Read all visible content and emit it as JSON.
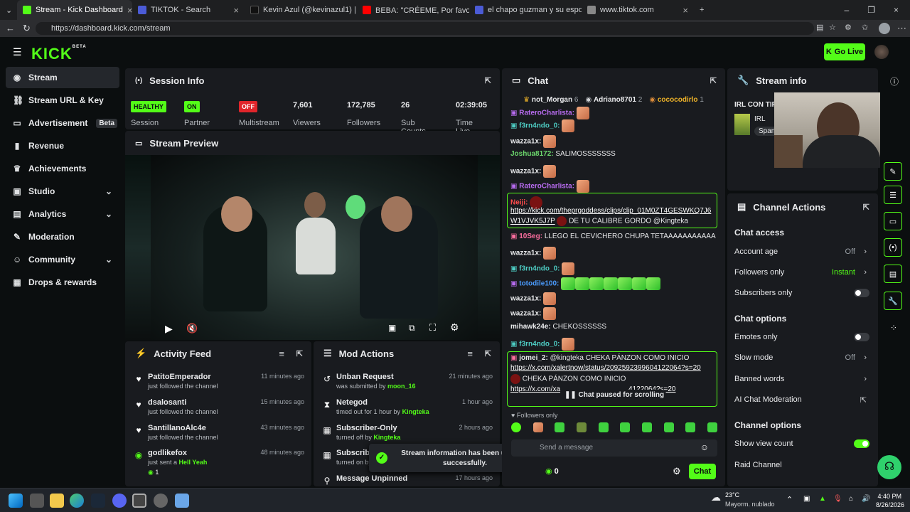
{
  "browser": {
    "tabs": [
      {
        "title": "Stream - Kick Dashboard",
        "fav": "#53fc18"
      },
      {
        "title": "TIKTOK - Search",
        "fav": "#4b5bd6"
      },
      {
        "title": "Kevin Azul (@kevinazul1) | TikTok",
        "fav": "#111111"
      },
      {
        "title": "BEBA: \"CRÉEME, Por favor\" 🙏",
        "fav": "#ff0000"
      },
      {
        "title": "el chapo guzman y su esposa - Se",
        "fav": "#4b5bd6"
      },
      {
        "title": "www.tiktok.com",
        "fav": "#888888"
      }
    ],
    "url": "https://dashboard.kick.com/stream"
  },
  "header": {
    "logo": "KICK",
    "logo_sup": "BETA",
    "go_live": "Go Live"
  },
  "sidebar": {
    "items": [
      {
        "label": "Stream",
        "icon": "signal-icon",
        "glyph": "((•))"
      },
      {
        "label": "Stream URL & Key",
        "icon": "link-icon",
        "glyph": "🔗"
      },
      {
        "label": "Advertisement",
        "icon": "ad-icon",
        "glyph": "▭"
      },
      {
        "label": "Revenue",
        "icon": "chart-icon",
        "glyph": "▮"
      },
      {
        "label": "Achievements",
        "icon": "trophy-icon",
        "glyph": "🏆"
      },
      {
        "label": "Studio",
        "icon": "studio-icon",
        "glyph": "▣"
      },
      {
        "label": "Analytics",
        "icon": "analytics-icon",
        "glyph": "▤"
      },
      {
        "label": "Moderation",
        "icon": "wrench-icon",
        "glyph": "✎"
      },
      {
        "label": "Community",
        "icon": "people-icon",
        "glyph": "☺"
      },
      {
        "label": "Drops & rewards",
        "icon": "gift-icon",
        "glyph": "▦"
      }
    ],
    "beta": "Beta"
  },
  "session": {
    "title": "Session Info",
    "stats": [
      {
        "badge": "HEALTHY",
        "label": "Session",
        "color": "#53fc18"
      },
      {
        "badge": "ON",
        "label": "Partner",
        "color": "#53fc18"
      },
      {
        "badge": "OFF",
        "label": "Multistream",
        "color": "#e0252b"
      },
      {
        "num": "7,601",
        "label": "Viewers"
      },
      {
        "num": "172,785",
        "label": "Followers"
      },
      {
        "num": "26",
        "label": "Sub Counts"
      },
      {
        "num": "02:39:05",
        "label": "Time Live"
      }
    ]
  },
  "preview": {
    "title": "Stream Preview"
  },
  "activity": {
    "title": "Activity Feed",
    "rows": [
      {
        "name": "PatitoEmperador",
        "desc": "just followed the channel",
        "time": "11 minutes ago",
        "icon": "heart-icon"
      },
      {
        "name": "dsalosanti",
        "desc": "just followed the channel",
        "time": "15 minutes ago",
        "icon": "heart-icon"
      },
      {
        "name": "SantillanoAlc4e",
        "desc": "just followed the channel",
        "time": "43 minutes ago",
        "icon": "heart-icon"
      },
      {
        "name": "godlikefox",
        "desc": "just sent a",
        "extra": "Hell Yeah",
        "count": "1",
        "time": "48 minutes ago",
        "icon": "kick-coin-icon"
      }
    ]
  },
  "mod": {
    "title": "Mod Actions",
    "rows": [
      {
        "name": "Unban Request",
        "desc": "was submitted by",
        "who": "moon_16",
        "time": "21 minutes ago"
      },
      {
        "name": "Netegod",
        "desc": "timed out for 1 hour by",
        "who": "Kingteka",
        "time": "1 hour ago"
      },
      {
        "name": "Subscriber-Only",
        "desc": "turned off by",
        "who": "Kingteka",
        "time": "2 hours ago"
      },
      {
        "name": "Subscriber",
        "desc": "turned on by",
        "who": "",
        "time": ""
      },
      {
        "name": "Message Unpinned",
        "desc": "",
        "who": "",
        "time": "17 hours ago"
      }
    ]
  },
  "toast": {
    "line1": "Stream information has been updated",
    "line2": "successfully."
  },
  "chat": {
    "title": "Chat",
    "top": [
      {
        "name": "not_Morgan",
        "n": "6"
      },
      {
        "name": "Adriano8701",
        "n": "2"
      },
      {
        "name": "cococodirlo",
        "n": "1"
      }
    ],
    "lines": [
      {
        "user": "RateroCharlista:",
        "text": "",
        "color": "#b86cf0"
      },
      {
        "user": "f3rn4ndo_0:",
        "text": "",
        "color": "#4ecdc4"
      },
      {
        "user": "wazza1x:",
        "text": "",
        "color": "#ffffff"
      },
      {
        "user": "Joshua8172:",
        "text": "SALIMOSSSSSSS",
        "color": "#6dd86d"
      },
      {
        "user": "wazza1x:",
        "text": "",
        "color": "#ffffff"
      },
      {
        "user": "RateroCharlista:",
        "text": "",
        "color": "#b86cf0"
      },
      {
        "user": "Neiji:",
        "text": "",
        "color": "#ff4d4d"
      },
      {
        "user": "",
        "text": "https://kick.com/theprgoddess/clips/clip_01M0ZT4GESWKQ7J6",
        "color": "#ffffff"
      },
      {
        "user": "",
        "text": "W1VJVK5J7P",
        "text2": "DE TU CALIBRE GORDO @Kingteka",
        "color": "#ffffff"
      },
      {
        "user": "10Seg:",
        "text": "LLEGO EL CEVICHERO CHUPA TETAAAAAAAAAAA",
        "color": "#ff6fa0"
      },
      {
        "user": "wazza1x:",
        "text": "",
        "color": "#ffffff"
      },
      {
        "user": "f3rn4ndo_0:",
        "text": "",
        "color": "#4ecdc4"
      },
      {
        "user": "totodile100:",
        "text": "",
        "color": "#4b9cff"
      },
      {
        "user": "wazza1x:",
        "text": "",
        "color": "#ffffff"
      },
      {
        "user": "wazza1x:",
        "text": "",
        "color": "#ffffff"
      },
      {
        "user": "mihawk24e:",
        "text": "CHEKOSSSSSS",
        "color": "#ffffff"
      },
      {
        "user": "f3rn4ndo_0:",
        "text": "",
        "color": "#4ecdc4"
      },
      {
        "user": "jomei_2:",
        "text": "@kingteka CHEKA PÁNZON COMO INICIO",
        "color": "#ffffff"
      },
      {
        "user": "",
        "text": "https://x.com/xalertnow/status/2092592399604122064?s=20",
        "color": "#ffffff"
      },
      {
        "user": "",
        "text": "CHEKA PÁNZON COMO INICIO",
        "color": "#ffffff"
      },
      {
        "user": "",
        "text": "https://x.com/xa",
        "text2": "4122064?s=20",
        "color": "#ffffff"
      }
    ],
    "paused": "Chat paused for scrolling",
    "followers_only": "Followers only",
    "placeholder": "Send a message",
    "coins": "0",
    "send": "Chat"
  },
  "stream_info": {
    "title": "Stream info",
    "stream_title": "IRL CON TIF",
    "category": "IRL",
    "tag": "Span"
  },
  "channel_actions": {
    "title": "Channel Actions",
    "chat_access": "Chat access",
    "account_age": {
      "label": "Account age",
      "value": "Off"
    },
    "followers_only": {
      "label": "Followers only",
      "value": "Instant"
    },
    "subs_only": {
      "label": "Subscribers only"
    },
    "chat_options": "Chat options",
    "emotes_only": {
      "label": "Emotes only"
    },
    "slow_mode": {
      "label": "Slow mode",
      "value": "Off"
    },
    "banned_words": {
      "label": "Banned words"
    },
    "ai_mod": {
      "label": "AI Chat Moderation"
    },
    "channel_options": "Channel options",
    "show_view_count": {
      "label": "Show view count"
    },
    "raid": {
      "label": "Raid Channel"
    }
  },
  "taskbar": {
    "temp": "23°C",
    "weather": "Mayorm. nublado",
    "time": "4:40 PM",
    "date": "8/26/2026"
  }
}
